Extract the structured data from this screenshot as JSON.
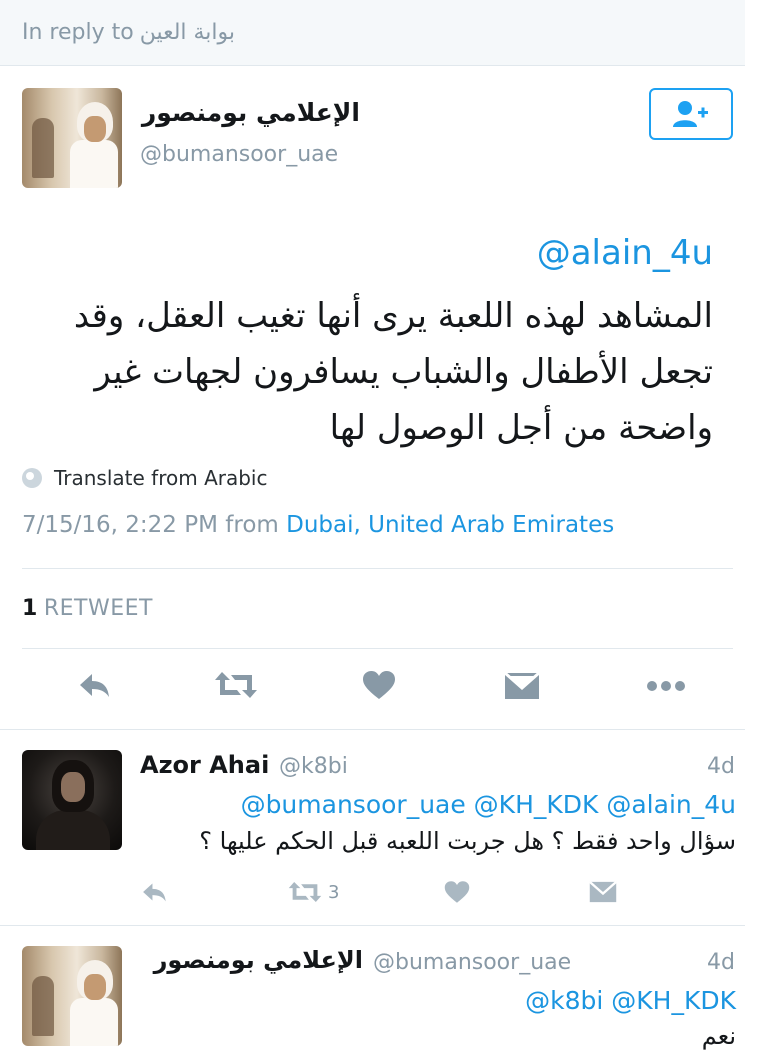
{
  "reply_bar": {
    "prefix": "In reply to",
    "user": "بوابة العين"
  },
  "main_tweet": {
    "author_name": "الإعلامي بومنصور",
    "author_handle": "@bumansoor_uae",
    "mention": "@alain_4u",
    "text": "المشاهد لهذه اللعبة يرى أنها تغيب العقل، وقد تجعل الأطفال والشباب يسافرون لجهات غير واضحة من أجل الوصول لها",
    "translate_label": "Translate from Arabic",
    "timestamp": "7/15/16, 2:22 PM from",
    "location": "Dubai, United Arab Emirates",
    "retweet_count": "1",
    "retweet_label": "RETWEET",
    "actions": [
      "reply",
      "retweet",
      "like",
      "message",
      "more"
    ]
  },
  "replies": [
    {
      "author_name": "Azor Ahai",
      "author_handle": "@k8bi",
      "time": "4d",
      "mentions": "@bumansoor_uae @KH_KDK @alain_4u",
      "text": "سؤال واحد فقط ؟ هل جربت اللعبه قبل الحكم عليها ؟",
      "retweet_count": "3"
    },
    {
      "author_name": "الإعلامي بومنصور",
      "author_handle": "@bumansoor_uae",
      "time": "4d",
      "mentions": "@k8bi @KH_KDK",
      "text": "نعم"
    }
  ],
  "colors": {
    "link": "#1b95e0",
    "muted": "#8899a6",
    "icon": "#8899a6",
    "follow": "#1da1f2"
  }
}
